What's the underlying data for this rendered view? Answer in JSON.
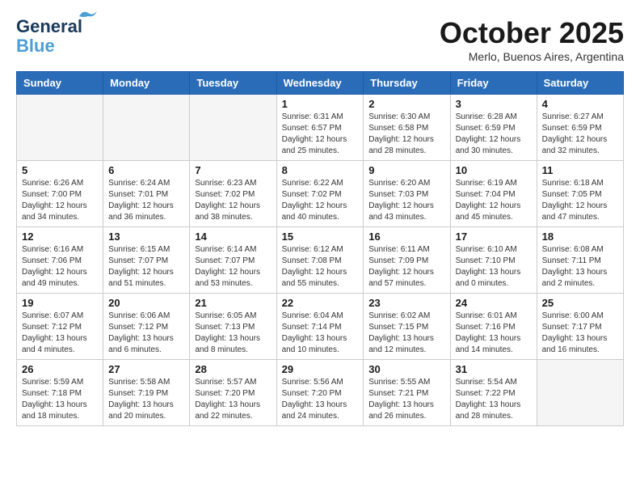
{
  "logo": {
    "line1": "General",
    "line2": "Blue"
  },
  "title": "October 2025",
  "subtitle": "Merlo, Buenos Aires, Argentina",
  "weekdays": [
    "Sunday",
    "Monday",
    "Tuesday",
    "Wednesday",
    "Thursday",
    "Friday",
    "Saturday"
  ],
  "weeks": [
    [
      {
        "day": "",
        "info": ""
      },
      {
        "day": "",
        "info": ""
      },
      {
        "day": "",
        "info": ""
      },
      {
        "day": "1",
        "info": "Sunrise: 6:31 AM\nSunset: 6:57 PM\nDaylight: 12 hours\nand 25 minutes."
      },
      {
        "day": "2",
        "info": "Sunrise: 6:30 AM\nSunset: 6:58 PM\nDaylight: 12 hours\nand 28 minutes."
      },
      {
        "day": "3",
        "info": "Sunrise: 6:28 AM\nSunset: 6:59 PM\nDaylight: 12 hours\nand 30 minutes."
      },
      {
        "day": "4",
        "info": "Sunrise: 6:27 AM\nSunset: 6:59 PM\nDaylight: 12 hours\nand 32 minutes."
      }
    ],
    [
      {
        "day": "5",
        "info": "Sunrise: 6:26 AM\nSunset: 7:00 PM\nDaylight: 12 hours\nand 34 minutes."
      },
      {
        "day": "6",
        "info": "Sunrise: 6:24 AM\nSunset: 7:01 PM\nDaylight: 12 hours\nand 36 minutes."
      },
      {
        "day": "7",
        "info": "Sunrise: 6:23 AM\nSunset: 7:02 PM\nDaylight: 12 hours\nand 38 minutes."
      },
      {
        "day": "8",
        "info": "Sunrise: 6:22 AM\nSunset: 7:02 PM\nDaylight: 12 hours\nand 40 minutes."
      },
      {
        "day": "9",
        "info": "Sunrise: 6:20 AM\nSunset: 7:03 PM\nDaylight: 12 hours\nand 43 minutes."
      },
      {
        "day": "10",
        "info": "Sunrise: 6:19 AM\nSunset: 7:04 PM\nDaylight: 12 hours\nand 45 minutes."
      },
      {
        "day": "11",
        "info": "Sunrise: 6:18 AM\nSunset: 7:05 PM\nDaylight: 12 hours\nand 47 minutes."
      }
    ],
    [
      {
        "day": "12",
        "info": "Sunrise: 6:16 AM\nSunset: 7:06 PM\nDaylight: 12 hours\nand 49 minutes."
      },
      {
        "day": "13",
        "info": "Sunrise: 6:15 AM\nSunset: 7:07 PM\nDaylight: 12 hours\nand 51 minutes."
      },
      {
        "day": "14",
        "info": "Sunrise: 6:14 AM\nSunset: 7:07 PM\nDaylight: 12 hours\nand 53 minutes."
      },
      {
        "day": "15",
        "info": "Sunrise: 6:12 AM\nSunset: 7:08 PM\nDaylight: 12 hours\nand 55 minutes."
      },
      {
        "day": "16",
        "info": "Sunrise: 6:11 AM\nSunset: 7:09 PM\nDaylight: 12 hours\nand 57 minutes."
      },
      {
        "day": "17",
        "info": "Sunrise: 6:10 AM\nSunset: 7:10 PM\nDaylight: 13 hours\nand 0 minutes."
      },
      {
        "day": "18",
        "info": "Sunrise: 6:08 AM\nSunset: 7:11 PM\nDaylight: 13 hours\nand 2 minutes."
      }
    ],
    [
      {
        "day": "19",
        "info": "Sunrise: 6:07 AM\nSunset: 7:12 PM\nDaylight: 13 hours\nand 4 minutes."
      },
      {
        "day": "20",
        "info": "Sunrise: 6:06 AM\nSunset: 7:12 PM\nDaylight: 13 hours\nand 6 minutes."
      },
      {
        "day": "21",
        "info": "Sunrise: 6:05 AM\nSunset: 7:13 PM\nDaylight: 13 hours\nand 8 minutes."
      },
      {
        "day": "22",
        "info": "Sunrise: 6:04 AM\nSunset: 7:14 PM\nDaylight: 13 hours\nand 10 minutes."
      },
      {
        "day": "23",
        "info": "Sunrise: 6:02 AM\nSunset: 7:15 PM\nDaylight: 13 hours\nand 12 minutes."
      },
      {
        "day": "24",
        "info": "Sunrise: 6:01 AM\nSunset: 7:16 PM\nDaylight: 13 hours\nand 14 minutes."
      },
      {
        "day": "25",
        "info": "Sunrise: 6:00 AM\nSunset: 7:17 PM\nDaylight: 13 hours\nand 16 minutes."
      }
    ],
    [
      {
        "day": "26",
        "info": "Sunrise: 5:59 AM\nSunset: 7:18 PM\nDaylight: 13 hours\nand 18 minutes."
      },
      {
        "day": "27",
        "info": "Sunrise: 5:58 AM\nSunset: 7:19 PM\nDaylight: 13 hours\nand 20 minutes."
      },
      {
        "day": "28",
        "info": "Sunrise: 5:57 AM\nSunset: 7:20 PM\nDaylight: 13 hours\nand 22 minutes."
      },
      {
        "day": "29",
        "info": "Sunrise: 5:56 AM\nSunset: 7:20 PM\nDaylight: 13 hours\nand 24 minutes."
      },
      {
        "day": "30",
        "info": "Sunrise: 5:55 AM\nSunset: 7:21 PM\nDaylight: 13 hours\nand 26 minutes."
      },
      {
        "day": "31",
        "info": "Sunrise: 5:54 AM\nSunset: 7:22 PM\nDaylight: 13 hours\nand 28 minutes."
      },
      {
        "day": "",
        "info": ""
      }
    ]
  ]
}
